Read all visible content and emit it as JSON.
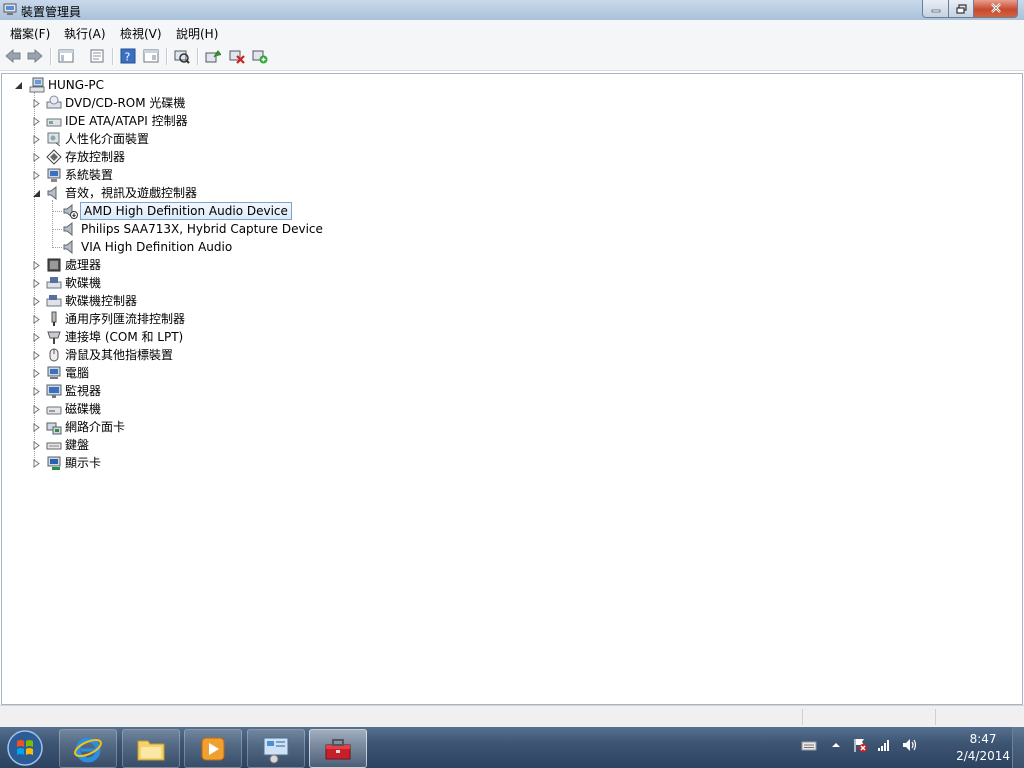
{
  "window": {
    "title": "裝置管理員"
  },
  "menu": [
    "檔案(F)",
    "執行(A)",
    "檢視(V)",
    "說明(H)"
  ],
  "toolbar_icons": [
    "back-arrow-icon",
    "forward-arrow-icon",
    "show-hide-tree-icon",
    "properties-icon",
    "help-icon",
    "action-pane-icon",
    "scan-hardware-icon",
    "update-driver-icon",
    "uninstall-icon",
    "enable-device-icon"
  ],
  "tree": {
    "root": "HUNG-PC",
    "categories": [
      {
        "label": "DVD/CD-ROM 光碟機",
        "icon": "dvd-drive-icon",
        "expanded": false
      },
      {
        "label": "IDE ATA/ATAPI 控制器",
        "icon": "ide-controller-icon",
        "expanded": false
      },
      {
        "label": "人性化介面裝置",
        "icon": "hid-icon",
        "expanded": false
      },
      {
        "label": "存放控制器",
        "icon": "storage-controller-icon",
        "expanded": false
      },
      {
        "label": "系統裝置",
        "icon": "system-device-icon",
        "expanded": false
      },
      {
        "label": "音效，視訊及遊戲控制器",
        "icon": "speaker-icon",
        "expanded": true,
        "children": [
          {
            "label": "AMD High Definition Audio Device",
            "selected": true
          },
          {
            "label": "Philips SAA713X, Hybrid Capture Device",
            "selected": false
          },
          {
            "label": "VIA High Definition Audio",
            "selected": false
          }
        ]
      },
      {
        "label": "處理器",
        "icon": "processor-icon",
        "expanded": false
      },
      {
        "label": "軟碟機",
        "icon": "floppy-drive-icon",
        "expanded": false
      },
      {
        "label": "軟碟機控制器",
        "icon": "floppy-controller-icon",
        "expanded": false
      },
      {
        "label": "通用序列匯流排控制器",
        "icon": "usb-controller-icon",
        "expanded": false
      },
      {
        "label": "連接埠 (COM 和 LPT)",
        "icon": "port-icon",
        "expanded": false
      },
      {
        "label": "滑鼠及其他指標裝置",
        "icon": "mouse-icon",
        "expanded": false
      },
      {
        "label": "電腦",
        "icon": "computer-icon",
        "expanded": false
      },
      {
        "label": "監視器",
        "icon": "monitor-icon",
        "expanded": false
      },
      {
        "label": "磁碟機",
        "icon": "disk-drive-icon",
        "expanded": false
      },
      {
        "label": "網路介面卡",
        "icon": "network-adapter-icon",
        "expanded": false
      },
      {
        "label": "鍵盤",
        "icon": "keyboard-icon",
        "expanded": false
      },
      {
        "label": "顯示卡",
        "icon": "display-adapter-icon",
        "expanded": false
      }
    ]
  },
  "taskbar": {
    "pinned": [
      "internet-explorer-icon",
      "file-explorer-icon",
      "media-player-icon",
      "control-panel-icon",
      "device-manager-toolbox-icon"
    ],
    "active_index": 4,
    "tray_icons": [
      "keyboard-tray-icon",
      "show-hidden-icons-arrow",
      "action-center-flag-icon",
      "network-signal-icon",
      "volume-icon"
    ],
    "time": "8:47",
    "date": "2/4/2014"
  },
  "colors": {
    "selection_border": "#7da2ce",
    "taskbar": "#3d5573",
    "titlebar": "#b9cde2",
    "close_button": "#c84a30"
  }
}
